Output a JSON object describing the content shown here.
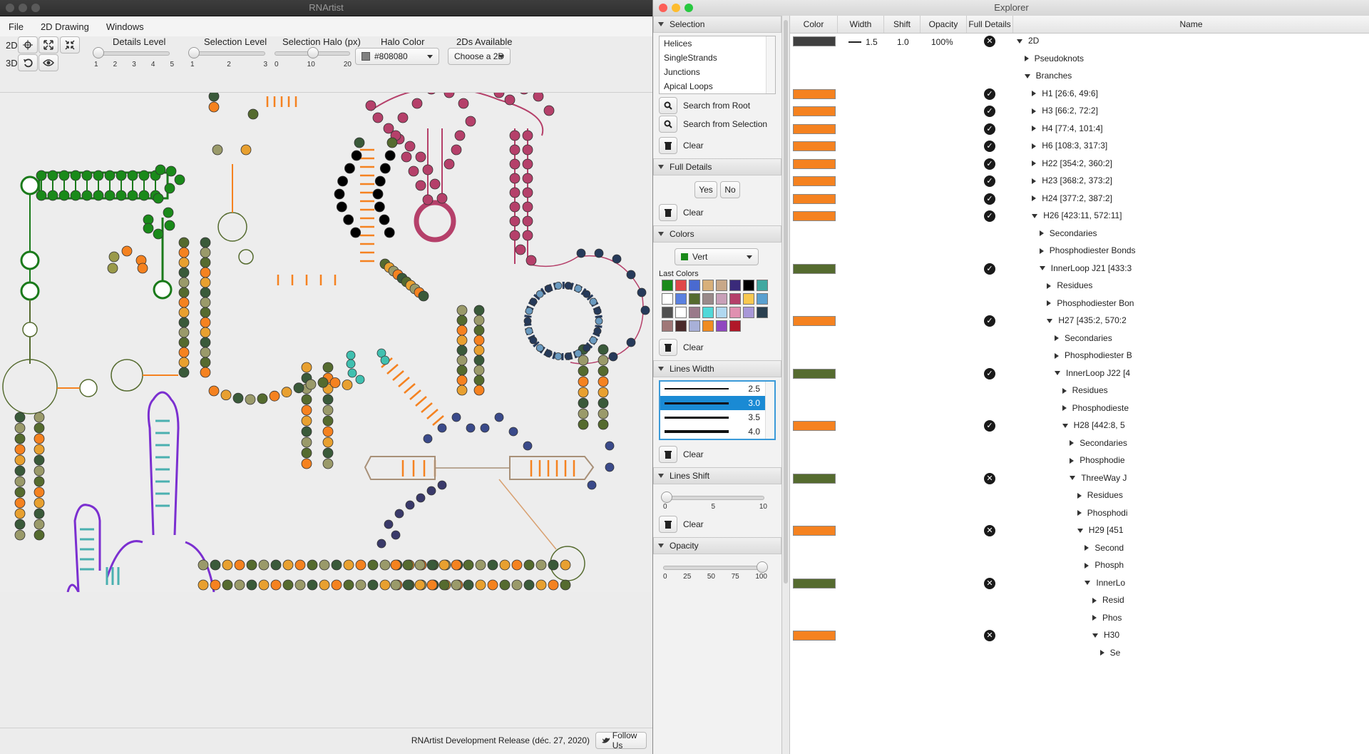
{
  "rnartist": {
    "title": "RNArtist",
    "menu": [
      "File",
      "2D Drawing",
      "Windows"
    ],
    "labels": {
      "mode2d": "2D",
      "mode3d": "3D"
    },
    "details_level": {
      "label": "Details Level",
      "ticks": [
        "1",
        "2",
        "3",
        "4",
        "5"
      ],
      "value": 1
    },
    "selection_level": {
      "label": "Selection Level",
      "ticks": [
        "1",
        "2",
        "3"
      ],
      "value": 1
    },
    "selection_halo": {
      "label": "Selection Halo (px)",
      "ticks": [
        "0",
        "10",
        "20"
      ],
      "value": 10
    },
    "halo_color": {
      "label": "Halo Color",
      "value": "#808080"
    },
    "twods": {
      "label": "2Ds Available",
      "value": "Choose a 2D"
    },
    "status": {
      "release": "RNArtist Development Release (déc. 27, 2020)",
      "follow": "Follow Us"
    },
    "colors": {
      "orange": "#f58220",
      "green": "#1a7a1a",
      "olive": "#556b2f",
      "magenta": "#b5406a",
      "purple": "#7b2fd0",
      "teal": "#4ab0b0",
      "navy": "#263a5a"
    }
  },
  "explorer": {
    "title": "Explorer",
    "selection": {
      "header": "Selection",
      "items": [
        "Helices",
        "SingleStrands",
        "Junctions",
        "Apical Loops"
      ],
      "search_root": "Search from Root",
      "search_selection": "Search from Selection",
      "clear": "Clear"
    },
    "full_details": {
      "header": "Full Details",
      "yes": "Yes",
      "no": "No",
      "clear": "Clear"
    },
    "colors": {
      "header": "Colors",
      "current": "Vert",
      "current_hex": "#1a8a1a",
      "last": "Last Colors",
      "palette": [
        "#1a8a1a",
        "#e04848",
        "#4a6ad0",
        "#d8b07a",
        "#c8a888",
        "#3a2a7a",
        "#000000",
        "#40a8a0",
        "#ffffff",
        "#5a80e0",
        "#556b2f",
        "#9a8a8a",
        "#c8a0b8",
        "#b5406a",
        "#f8c850",
        "#5aa0d0",
        "#505050",
        "#ffffff",
        "#9a7a8a",
        "#50d8d8",
        "#b0d8f0",
        "#e090b0",
        "#a898d8",
        "#2a4050",
        "#a07878",
        "#4a2a2a",
        "#a8b0d8",
        "#f08c20",
        "#9048c0",
        "#b01828"
      ],
      "clear": "Clear"
    },
    "lines_width": {
      "header": "Lines Width",
      "items": [
        "2.5",
        "3.0",
        "3.5",
        "4.0"
      ],
      "selected": "3.0",
      "clear": "Clear"
    },
    "lines_shift": {
      "header": "Lines Shift",
      "ticks": [
        "0",
        "5",
        "10"
      ],
      "value": 0,
      "clear": "Clear"
    },
    "opacity": {
      "header": "Opacity",
      "ticks": [
        "0",
        "25",
        "50",
        "75",
        "100"
      ],
      "value": 100
    },
    "table": {
      "columns": [
        "Color",
        "Width",
        "Shift",
        "Opacity",
        "Full Details",
        "Name"
      ],
      "first_row": {
        "width": "1.5",
        "shift": "1.0",
        "opacity": "100%"
      },
      "rows": [
        {
          "color": "#404040",
          "check": "x",
          "name": "2D",
          "indent": 0,
          "open": true,
          "showprops": true
        },
        {
          "color": "",
          "check": "",
          "name": "Pseudoknots",
          "indent": 1,
          "open": false
        },
        {
          "color": "",
          "check": "",
          "name": "Branches",
          "indent": 1,
          "open": true
        },
        {
          "color": "#f58220",
          "check": "v",
          "name": "H1 [26:6, 49:6]",
          "indent": 2,
          "open": false
        },
        {
          "color": "#f58220",
          "check": "v",
          "name": "H3 [66:2, 72:2]",
          "indent": 2,
          "open": false
        },
        {
          "color": "#f58220",
          "check": "v",
          "name": "H4 [77:4, 101:4]",
          "indent": 2,
          "open": false
        },
        {
          "color": "#f58220",
          "check": "v",
          "name": "H6 [108:3, 317:3]",
          "indent": 2,
          "open": false
        },
        {
          "color": "#f58220",
          "check": "v",
          "name": "H22 [354:2, 360:2]",
          "indent": 2,
          "open": false
        },
        {
          "color": "#f58220",
          "check": "v",
          "name": "H23 [368:2, 373:2]",
          "indent": 2,
          "open": false
        },
        {
          "color": "#f58220",
          "check": "v",
          "name": "H24 [377:2, 387:2]",
          "indent": 2,
          "open": false
        },
        {
          "color": "#f58220",
          "check": "v",
          "name": "H26 [423:11, 572:11]",
          "indent": 2,
          "open": true
        },
        {
          "color": "",
          "check": "",
          "name": "Secondaries",
          "indent": 3,
          "open": false
        },
        {
          "color": "",
          "check": "",
          "name": "Phosphodiester Bonds",
          "indent": 3,
          "open": false
        },
        {
          "color": "#556b2f",
          "check": "v",
          "name": "InnerLoop J21 [433:3",
          "indent": 3,
          "open": true
        },
        {
          "color": "",
          "check": "",
          "name": "Residues",
          "indent": 4,
          "open": false
        },
        {
          "color": "",
          "check": "",
          "name": "Phosphodiester Bon",
          "indent": 4,
          "open": false
        },
        {
          "color": "#f58220",
          "check": "v",
          "name": "H27 [435:2, 570:2",
          "indent": 4,
          "open": true
        },
        {
          "color": "",
          "check": "",
          "name": "Secondaries",
          "indent": 5,
          "open": false
        },
        {
          "color": "",
          "check": "",
          "name": "Phosphodiester B",
          "indent": 5,
          "open": false
        },
        {
          "color": "#556b2f",
          "check": "v",
          "name": "InnerLoop J22 [4",
          "indent": 5,
          "open": true
        },
        {
          "color": "",
          "check": "",
          "name": "Residues",
          "indent": 6,
          "open": false
        },
        {
          "color": "",
          "check": "",
          "name": "Phosphodieste",
          "indent": 6,
          "open": false
        },
        {
          "color": "#f58220",
          "check": "v",
          "name": "H28 [442:8, 5",
          "indent": 6,
          "open": true
        },
        {
          "color": "",
          "check": "",
          "name": "Secondaries",
          "indent": 7,
          "open": false
        },
        {
          "color": "",
          "check": "",
          "name": "Phosphodie",
          "indent": 7,
          "open": false
        },
        {
          "color": "#556b2f",
          "check": "x",
          "name": "ThreeWay J",
          "indent": 7,
          "open": true
        },
        {
          "color": "",
          "check": "",
          "name": "Residues",
          "indent": 8,
          "open": false
        },
        {
          "color": "",
          "check": "",
          "name": "Phosphodi",
          "indent": 8,
          "open": false
        },
        {
          "color": "#f58220",
          "check": "x",
          "name": "H29 [451",
          "indent": 8,
          "open": true
        },
        {
          "color": "",
          "check": "",
          "name": "Second",
          "indent": 9,
          "open": false
        },
        {
          "color": "",
          "check": "",
          "name": "Phosph",
          "indent": 9,
          "open": false
        },
        {
          "color": "#556b2f",
          "check": "x",
          "name": "InnerLo",
          "indent": 9,
          "open": true
        },
        {
          "color": "",
          "check": "",
          "name": "Resid",
          "indent": 10,
          "open": false
        },
        {
          "color": "",
          "check": "",
          "name": "Phos",
          "indent": 10,
          "open": false
        },
        {
          "color": "#f58220",
          "check": "x",
          "name": "H30",
          "indent": 10,
          "open": true
        },
        {
          "color": "",
          "check": "",
          "name": "Se",
          "indent": 11,
          "open": false
        }
      ]
    }
  }
}
